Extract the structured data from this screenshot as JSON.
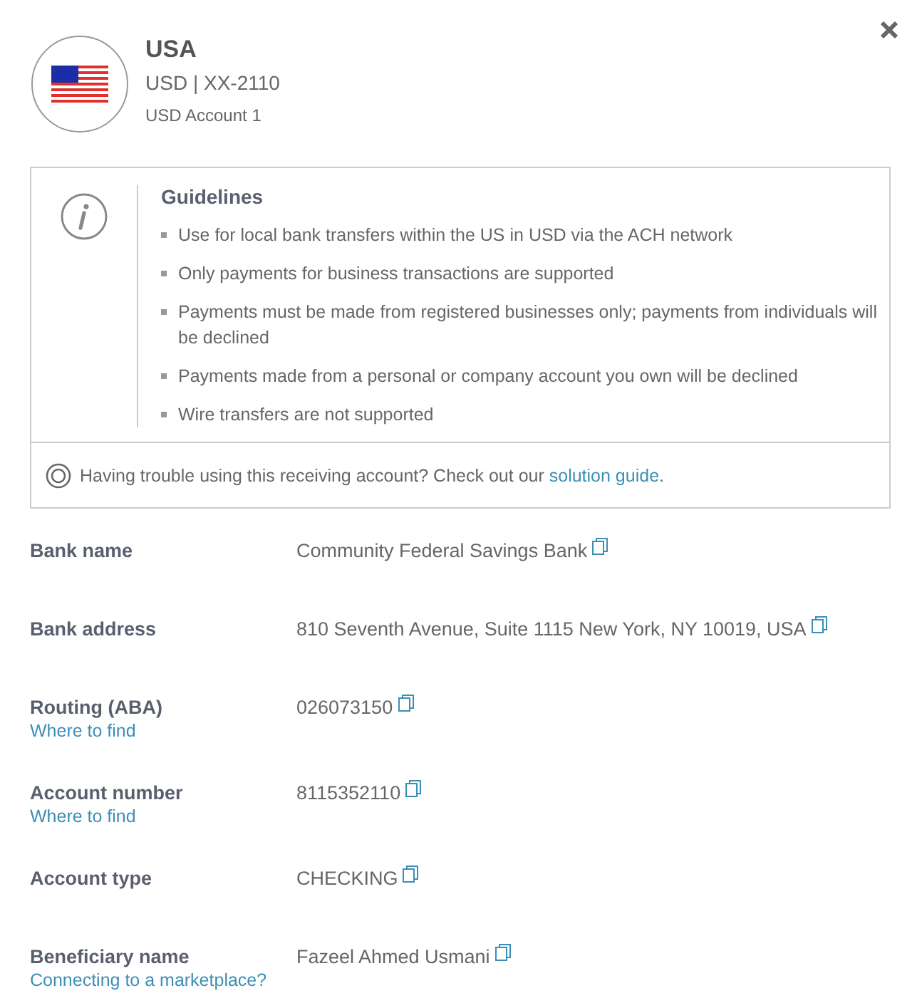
{
  "header": {
    "country": "USA",
    "currency_line": "USD | XX-2110",
    "account_name": "USD Account 1"
  },
  "guidelines": {
    "title": "Guidelines",
    "items": [
      "Use for local bank transfers within the US in USD via the ACH network",
      "Only payments for business transactions are supported",
      "Payments must be made from registered businesses only; payments from individuals will be declined",
      "Payments made from a personal or company account you own will be declined",
      "Wire transfers are not supported"
    ],
    "help_text": "Having trouble using this receiving account? Check out our",
    "help_link": "solution guide",
    "help_end": "."
  },
  "details": [
    {
      "label": "Bank name",
      "value": "Community Federal Savings Bank"
    },
    {
      "label": "Bank address",
      "value": "810 Seventh Avenue, Suite 1115 New York, NY 10019, USA"
    },
    {
      "label": "Routing (ABA)",
      "link": "Where to find",
      "value": "026073150"
    },
    {
      "label": "Account number",
      "link": "Where to find",
      "value": "8115352110"
    },
    {
      "label": "Account type",
      "value": "CHECKING"
    },
    {
      "label": "Beneficiary name",
      "link": "Connecting to a marketplace?",
      "value": "Fazeel Ahmed Usmani"
    }
  ]
}
